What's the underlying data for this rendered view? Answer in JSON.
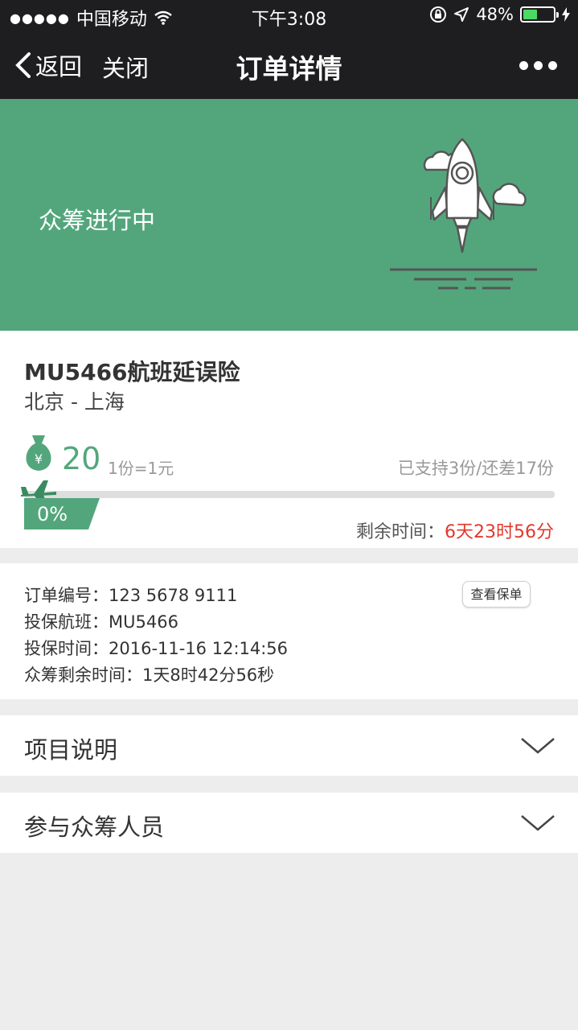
{
  "status_bar": {
    "carrier": "中国移动",
    "time": "下午3:08",
    "battery": "48%",
    "battery_level": 0.48
  },
  "nav": {
    "back_label": "返回",
    "close_label": "关闭",
    "title": "订单详情"
  },
  "banner": {
    "status_text": "众筹进行中"
  },
  "product": {
    "name": "MU5466航班延误险",
    "route": "北京 - 上海",
    "amount": "20",
    "unit_price": "1份=1元",
    "support_status": "已支持3份/还差17份",
    "progress_label": "0%",
    "progress": 0,
    "remaining_label": "剩余时间：",
    "remaining_value": "6天23时56分"
  },
  "order": {
    "number": "订单编号：123 5678 9111",
    "flight": "投保航班：MU5466",
    "time": "投保时间：2016-11-16 12:14:56",
    "crowd_remaining": "众筹剩余时间：1天8时42分56秒",
    "view_policy_label": "查看保单"
  },
  "sections": {
    "project_desc": "项目说明",
    "participants": "参与众筹人员"
  },
  "colors": {
    "brand_green": "#53a67c",
    "alert_red": "#e2382c",
    "nav_bg": "#1e1e20"
  }
}
